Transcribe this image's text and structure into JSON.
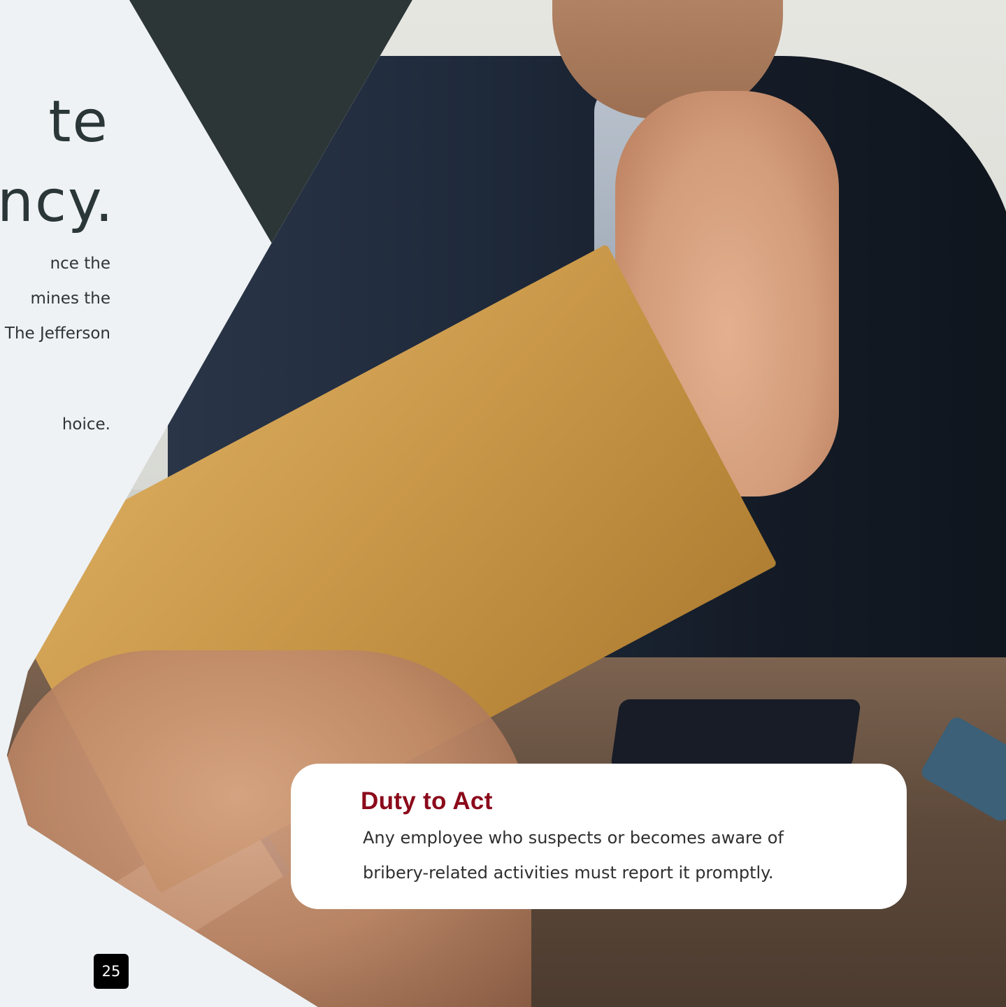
{
  "title": {
    "line1": "te",
    "line2": "ncy."
  },
  "intro": {
    "line1": "nce the",
    "line2": "mines the",
    "line3": "The Jefferson",
    "line4": "hoice."
  },
  "callout": {
    "heading": "Duty to Act",
    "line1": "Any employee who suspects or becomes aware of",
    "line2": "bribery-related activities must report it  promptly."
  },
  "page_number": "25",
  "colors": {
    "background": "#eef2f5",
    "dark_shape": "#2c3637",
    "heading_red": "#8b0a1b"
  }
}
